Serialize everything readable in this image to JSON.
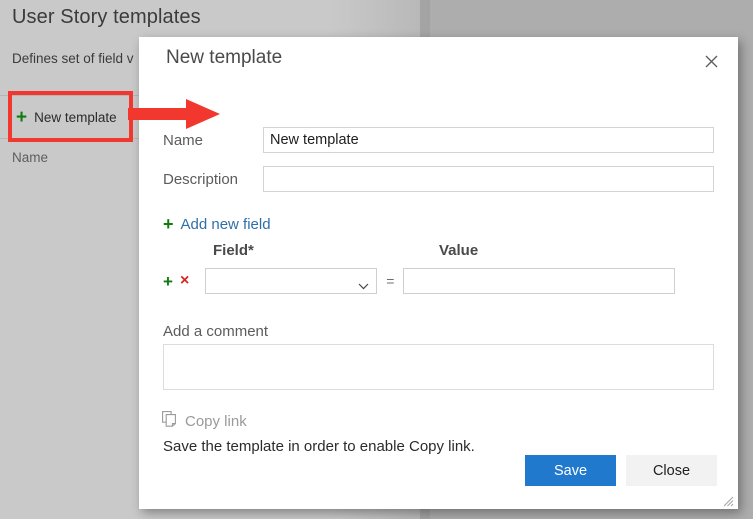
{
  "background": {
    "page_title": "User Story templates",
    "page_subtitle": "Defines set of field v",
    "new_template_button": "New template",
    "plus_icon": "+",
    "column_header_name": "Name"
  },
  "dialog": {
    "title": "New template",
    "close_icon": "close-icon",
    "fields": {
      "name_label": "Name",
      "name_value": "New template",
      "name_placeholder": "",
      "description_label": "Description",
      "description_value": "",
      "description_placeholder": ""
    },
    "add_new_field": {
      "plus_icon": "+",
      "label": "Add new field"
    },
    "field_table": {
      "col_field": "Field*",
      "col_value": "Value",
      "rows": [
        {
          "add_icon": "+",
          "remove_icon": "×",
          "field_selected": "",
          "field_placeholder": "",
          "equals": "=",
          "value": "",
          "value_placeholder": ""
        }
      ]
    },
    "comment": {
      "label": "Add a comment",
      "value": "",
      "placeholder": ""
    },
    "copy_link": {
      "icon": "copy-icon",
      "label": "Copy link",
      "hint": "Save the template in order to enable Copy link."
    },
    "footer": {
      "save_label": "Save",
      "close_label": "Close"
    }
  },
  "colors": {
    "accent_blue": "#2079cd",
    "link_blue": "#2f6fa8",
    "green_plus": "#107c10",
    "red_x": "#d6271f",
    "annotation_red": "#f2372f",
    "overlay_gray": "#c9c9c9"
  },
  "annotations": {
    "highlight_box": "red-rectangle-around-new-template-button",
    "arrow": "red-arrow-pointing-right"
  }
}
